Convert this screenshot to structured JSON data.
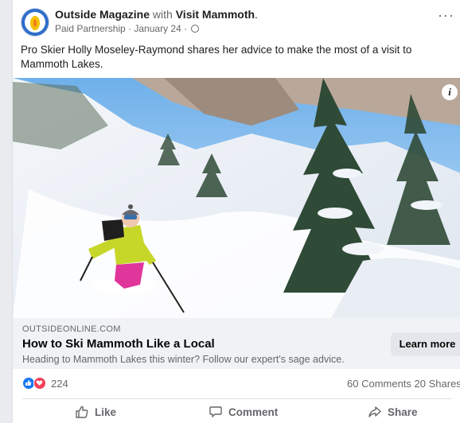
{
  "post": {
    "page_name": "Outside Magazine",
    "with_text": "with",
    "partner_name": "Visit Mammoth",
    "partner_suffix": ".",
    "meta": "Paid Partnership · January 24 ·",
    "more_label": "···",
    "message": "Pro Skier Holly Moseley-Raymond shares her advice to make the most of a visit to Mammoth Lakes.",
    "info_label": "i"
  },
  "link": {
    "domain": "OUTSIDEONLINE.COM",
    "title": "How to Ski Mammoth Like a Local",
    "description": "Heading to Mammoth Lakes this winter? Follow our expert's sage advice.",
    "cta": "Learn more"
  },
  "stats": {
    "reactions_count": "224",
    "comments_shares": "60 Comments  20 Shares"
  },
  "actions": {
    "like": "Like",
    "comment": "Comment",
    "share": "Share"
  },
  "colors": {
    "like_blue": "#1877f2",
    "love_red": "#f33e58"
  }
}
